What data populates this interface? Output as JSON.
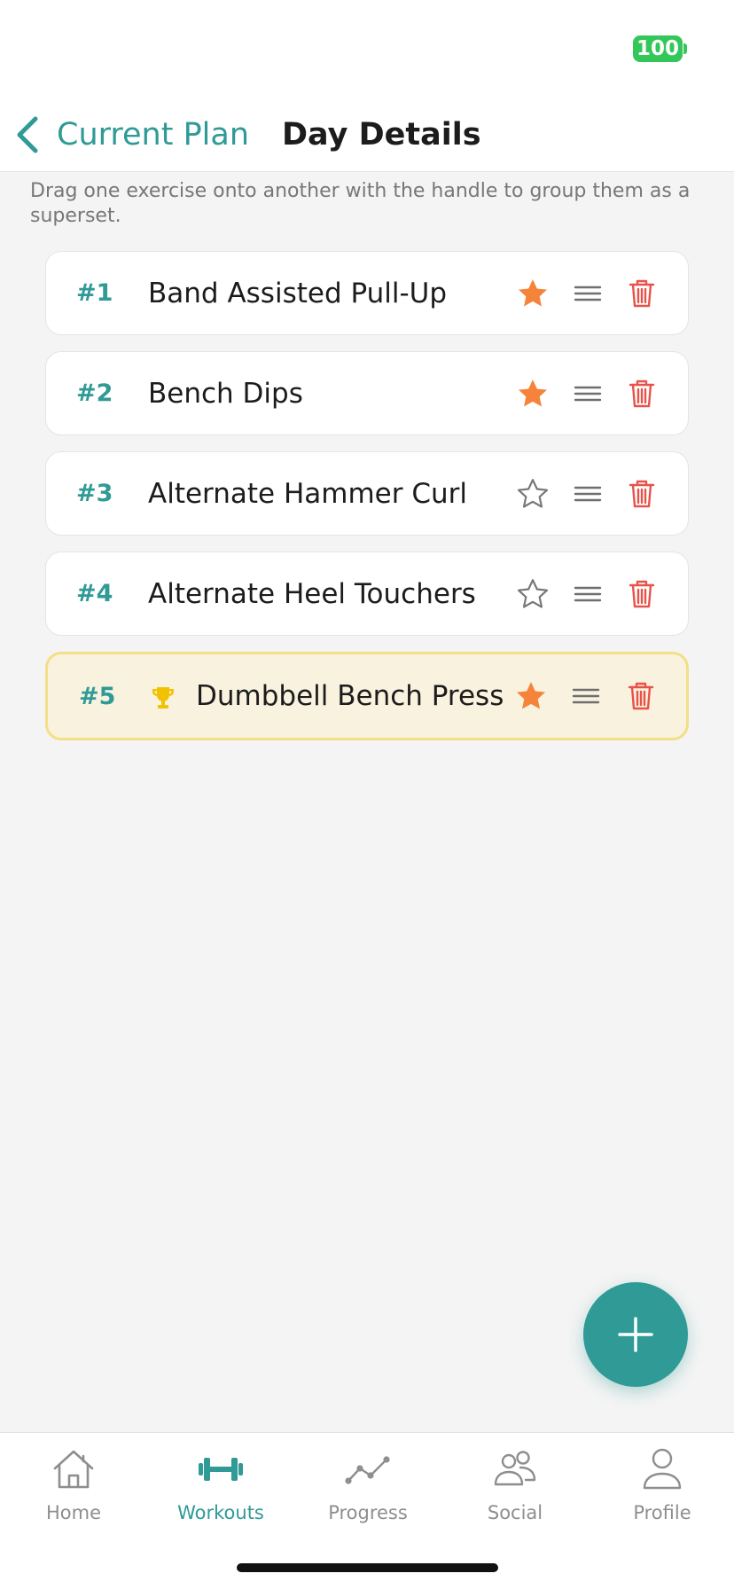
{
  "status": {
    "battery": "100"
  },
  "nav": {
    "back_label": "Current Plan",
    "title": "Day Details"
  },
  "hint": "Drag one exercise onto another with the handle to group them as a superset.",
  "exercises": [
    {
      "num": "#1",
      "name": "Band Assisted Pull-Up",
      "favorite": true
    },
    {
      "num": "#2",
      "name": "Bench Dips",
      "favorite": true
    },
    {
      "num": "#3",
      "name": "Alternate Hammer Curl",
      "favorite": false
    },
    {
      "num": "#4",
      "name": "Alternate Heel Touchers",
      "favorite": false
    },
    {
      "num": "#5",
      "name": "Dumbbell Bench Press",
      "favorite": true,
      "trophy": true,
      "highlighted": true
    }
  ],
  "tabs": [
    {
      "label": "Home",
      "icon": "home-icon",
      "active": false
    },
    {
      "label": "Workouts",
      "icon": "dumbbell-icon",
      "active": true
    },
    {
      "label": "Progress",
      "icon": "chart-line-icon",
      "active": false
    },
    {
      "label": "Social",
      "icon": "people-icon",
      "active": false
    },
    {
      "label": "Profile",
      "icon": "person-icon",
      "active": false
    }
  ],
  "colors": {
    "accent": "#2f9a96",
    "star_on": "#f5843a",
    "star_off": "#777777",
    "trash": "#e8524a",
    "trophy": "#f2c200",
    "highlight_bg": "#f8f2df",
    "highlight_border": "#f3df86"
  }
}
